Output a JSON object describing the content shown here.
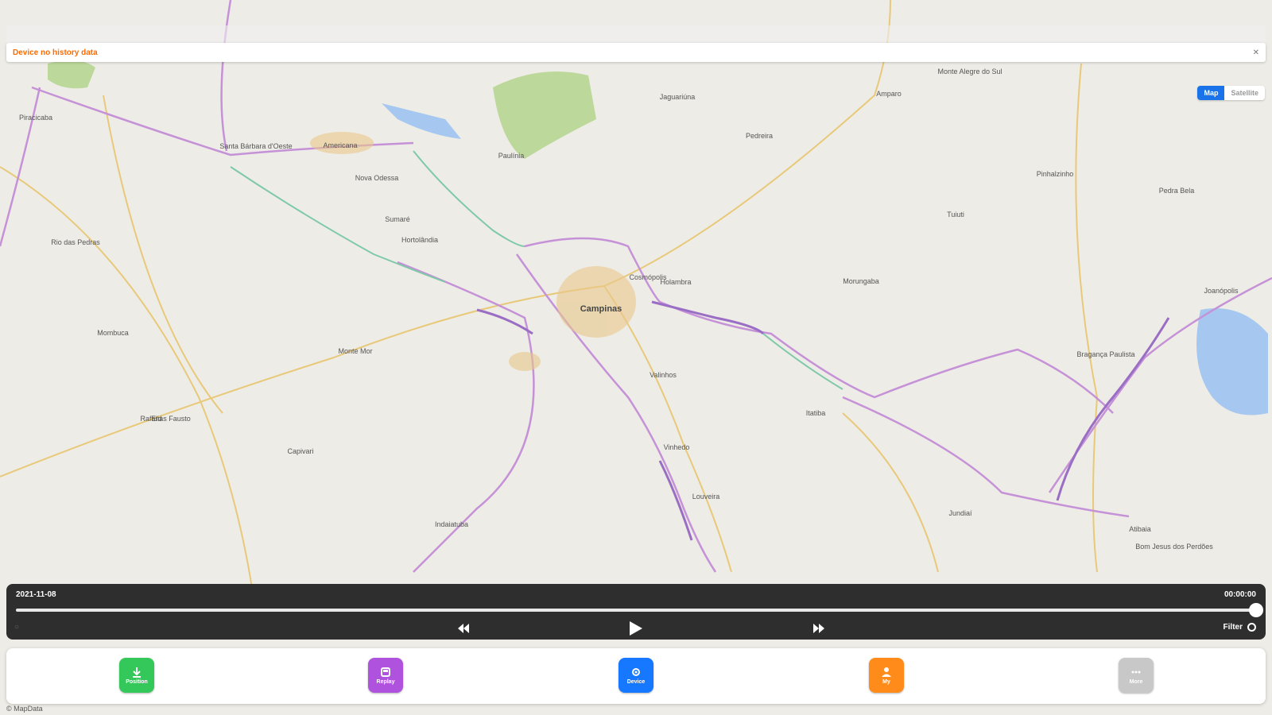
{
  "alert": {
    "text": "Device no history data",
    "close_icon": "close-icon"
  },
  "map_type": {
    "map_label": "Map",
    "satellite_label": "Satellite",
    "active": "Map"
  },
  "map_labels": [
    {
      "text": "Piracicaba",
      "major": false
    },
    {
      "text": "Santa Bárbara d'Oeste",
      "major": false
    },
    {
      "text": "Americana",
      "major": false
    },
    {
      "text": "Nova Odessa",
      "major": false
    },
    {
      "text": "Sumaré",
      "major": false
    },
    {
      "text": "Hortolândia",
      "major": false
    },
    {
      "text": "Paulínia",
      "major": false
    },
    {
      "text": "Jaguariúna",
      "major": false
    },
    {
      "text": "Pedreira",
      "major": false
    },
    {
      "text": "Amparo",
      "major": false
    },
    {
      "text": "Monte Mor",
      "major": false
    },
    {
      "text": "Campinas",
      "major": true
    },
    {
      "text": "Valinhos",
      "major": false
    },
    {
      "text": "Vinhedo",
      "major": false
    },
    {
      "text": "Itatiba",
      "major": false
    },
    {
      "text": "Morungaba",
      "major": false
    },
    {
      "text": "Bragança Paulista",
      "major": false
    },
    {
      "text": "Atibaia",
      "major": false
    },
    {
      "text": "Louveira",
      "major": false
    },
    {
      "text": "Indaiatuba",
      "major": false
    },
    {
      "text": "Jundiaí",
      "major": false
    },
    {
      "text": "Elias Fausto",
      "major": false
    },
    {
      "text": "Capivari",
      "major": false
    },
    {
      "text": "Rafard",
      "major": false
    },
    {
      "text": "Mombuca",
      "major": false
    },
    {
      "text": "Rio das Pedras",
      "major": false
    },
    {
      "text": "Monte Alegre do Sul",
      "major": false
    },
    {
      "text": "Tuiuti",
      "major": false
    },
    {
      "text": "Pinhalzinho",
      "major": false
    },
    {
      "text": "Pedra Bela",
      "major": false
    },
    {
      "text": "Joanópolis",
      "major": false
    },
    {
      "text": "Bom Jesus dos Perdões",
      "major": false
    },
    {
      "text": "Holambra",
      "major": false
    },
    {
      "text": "Cosmópolis",
      "major": false
    }
  ],
  "player": {
    "date": "2021-11-08",
    "time": "00:00:00",
    "left_icon": "circle-icon",
    "progress": 1.0,
    "rewind_icon": "rewind-icon",
    "play_icon": "play-icon",
    "forward_icon": "fast-forward-icon",
    "filter_label": "Filter",
    "filter_icon": "filter-icon"
  },
  "dock": {
    "items": [
      {
        "label": "Position",
        "icon": "download-icon",
        "color": "#34c759"
      },
      {
        "label": "Replay",
        "icon": "replay-icon",
        "color": "#af52de"
      },
      {
        "label": "Device",
        "icon": "device-icon",
        "color": "#1677ff"
      },
      {
        "label": "My",
        "icon": "user-icon",
        "color": "#ff8c1a"
      },
      {
        "label": "More",
        "icon": "more-icon",
        "color": "#c8c8c8"
      }
    ]
  },
  "attribution": "© MapData"
}
